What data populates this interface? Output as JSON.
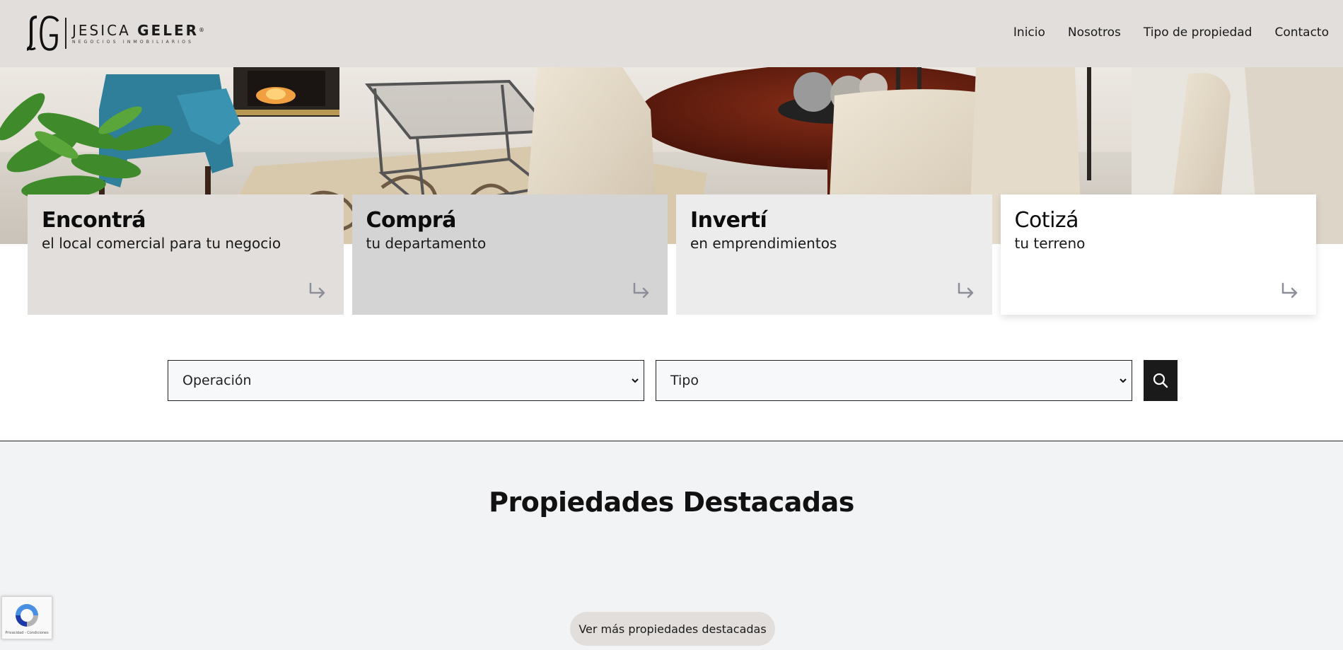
{
  "brand": {
    "name_first": "JESICA",
    "name_last": "GELER",
    "registered": "®",
    "tagline": "NEGOCIOS INMOBILIARIOS"
  },
  "nav": [
    {
      "label": "Inicio"
    },
    {
      "label": "Nosotros"
    },
    {
      "label": "Tipo de propiedad"
    },
    {
      "label": "Contacto"
    }
  ],
  "cards": [
    {
      "title": "Encontrá",
      "subtitle": "el local comercial para tu negocio"
    },
    {
      "title": "Comprá",
      "subtitle": "tu departamento"
    },
    {
      "title": "Invertí",
      "subtitle": "en emprendimientos"
    },
    {
      "title": "Cotizá",
      "subtitle": "tu terreno"
    }
  ],
  "search": {
    "operation_label": "Operación",
    "type_label": "Tipo"
  },
  "featured": {
    "title": "Propiedades Destacadas",
    "more_label": "Ver más propiedades destacadas"
  },
  "recaptcha": {
    "footer": "Privacidad - Condiciones"
  },
  "colors": {
    "header_bg": "#e2dedb",
    "card1_bg": "#e2dedb",
    "card2_bg": "#d4d4d4",
    "card3_bg": "#ececec",
    "card4_bg": "#ffffff",
    "search_button": "#1a1a1a",
    "featured_bg": "#f2f3f5"
  }
}
